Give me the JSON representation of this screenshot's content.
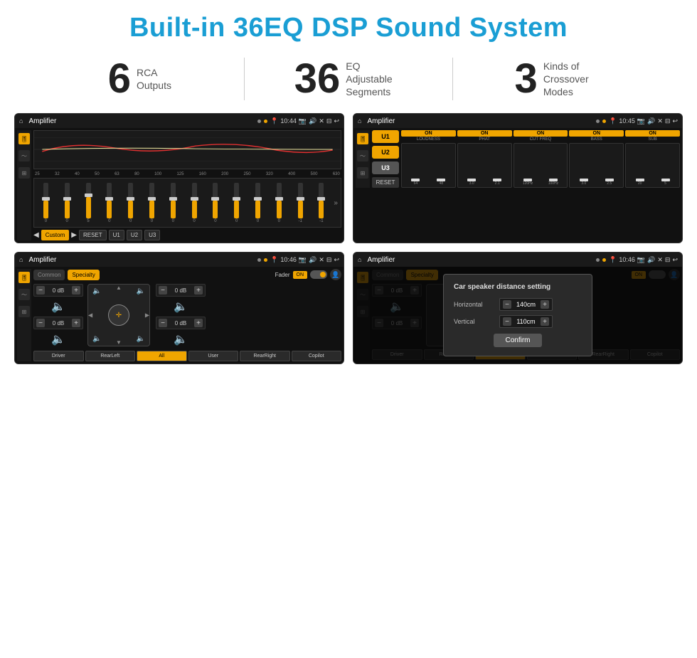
{
  "header": {
    "title": "Built-in 36EQ DSP Sound System"
  },
  "stats": [
    {
      "number": "6",
      "text": "RCA\nOutputs"
    },
    {
      "number": "36",
      "text": "EQ Adjustable\nSegments"
    },
    {
      "number": "3",
      "text": "Kinds of\nCrossover Modes"
    }
  ],
  "screens": [
    {
      "id": "screen1",
      "statusBar": {
        "title": "Amplifier",
        "time": "10:44"
      },
      "type": "eq"
    },
    {
      "id": "screen2",
      "statusBar": {
        "title": "Amplifier",
        "time": "10:45"
      },
      "type": "crossover"
    },
    {
      "id": "screen3",
      "statusBar": {
        "title": "Amplifier",
        "time": "10:46"
      },
      "type": "fader"
    },
    {
      "id": "screen4",
      "statusBar": {
        "title": "Amplifier",
        "time": "10:46"
      },
      "type": "distance",
      "modal": {
        "title": "Car speaker distance setting",
        "horizontal": "140cm",
        "vertical": "110cm",
        "confirmLabel": "Confirm"
      }
    }
  ],
  "eq": {
    "freqs": [
      "25",
      "32",
      "40",
      "50",
      "63",
      "80",
      "100",
      "125",
      "160",
      "200",
      "250",
      "320",
      "400",
      "500",
      "630"
    ],
    "values": [
      "0",
      "0",
      "0",
      "5",
      "0",
      "0",
      "0",
      "0",
      "0",
      "0",
      "0",
      "0",
      "-1",
      "-1"
    ],
    "presets": [
      "Custom",
      "RESET",
      "U1",
      "U2",
      "U3"
    ]
  },
  "crossover": {
    "channels": [
      "LOUDNESS",
      "PHAT",
      "CUT FREQ",
      "BASS",
      "SUB"
    ],
    "uButtons": [
      "U1",
      "U2",
      "U3"
    ],
    "resetLabel": "RESET"
  },
  "fader": {
    "tabs": [
      "Common",
      "Specialty"
    ],
    "label": "Fader",
    "toggle": "ON",
    "channels": [
      {
        "label": "0 dB"
      },
      {
        "label": "0 dB"
      },
      {
        "label": "0 dB"
      },
      {
        "label": "0 dB"
      }
    ],
    "bottomBtns": [
      "Driver",
      "RearLeft",
      "All",
      "User",
      "RearRight",
      "Copilot"
    ]
  },
  "distance": {
    "tabs": [
      "Common",
      "Specialty"
    ],
    "toggle": "ON",
    "modal": {
      "title": "Car speaker distance setting",
      "horizontalLabel": "Horizontal",
      "horizontalValue": "140cm",
      "verticalLabel": "Vertical",
      "verticalValue": "110cm",
      "confirmLabel": "Confirm"
    },
    "bottomBtns": [
      "Driver",
      "RearLeft",
      "All",
      "User",
      "RearRight",
      "Copilot"
    ],
    "dbValues": [
      "0 dB",
      "0 dB"
    ]
  }
}
